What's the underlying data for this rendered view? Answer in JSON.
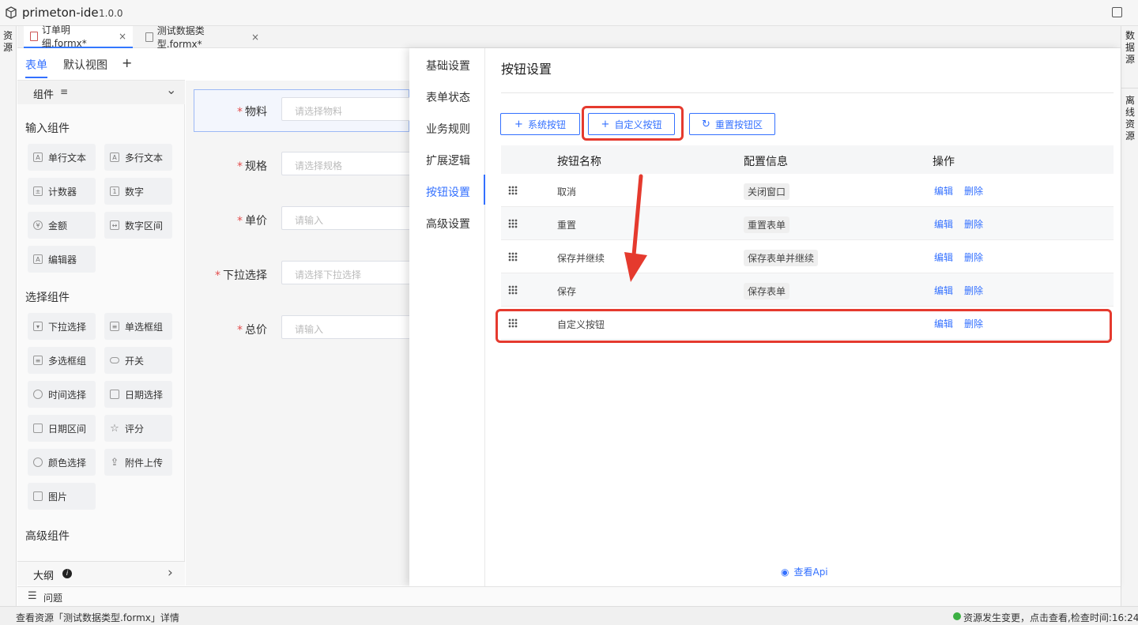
{
  "app": {
    "name": "primeton-ide",
    "version": "1.0.0"
  },
  "left_strip": {
    "label": "资源"
  },
  "right_strip": {
    "data_source": "数据源",
    "offline_resource": "离线资源"
  },
  "file_tabs": [
    {
      "label": "订单明细.formx*",
      "close": "×"
    },
    {
      "label": "测试数据类型.formx*",
      "close": "×"
    }
  ],
  "top_nav": {
    "form": "表单",
    "default_view": "默认视图",
    "add": "+"
  },
  "components": {
    "header": "组件",
    "header_icon": "≡",
    "chevron": "⌄",
    "input_title": "输入组件",
    "input_items": [
      "单行文本",
      "多行文本",
      "计数器",
      "数字",
      "金额",
      "数字区间",
      "编辑器"
    ],
    "select_title": "选择组件",
    "select_items": [
      "下拉选择",
      "单选框组",
      "多选框组",
      "开关",
      "时间选择",
      "日期选择",
      "日期区间",
      "评分",
      "颜色选择",
      "附件上传",
      "图片"
    ],
    "advanced_title": "高级组件"
  },
  "outline": {
    "label": "大纲",
    "info": "i",
    "chevron": "›"
  },
  "problems": {
    "label": "问题"
  },
  "form_fields": [
    {
      "label": "物料",
      "placeholder": "请选择物料"
    },
    {
      "label": "规格",
      "placeholder": "请选择规格"
    },
    {
      "label": "单价",
      "placeholder": "请输入"
    },
    {
      "label": "下拉选择",
      "placeholder": "请选择下拉选择"
    },
    {
      "label": "总价",
      "placeholder": "请输入"
    }
  ],
  "drawer": {
    "menu": [
      "基础设置",
      "表单状态",
      "业务规则",
      "扩展逻辑",
      "按钮设置",
      "高级设置"
    ],
    "active_menu": "按钮设置",
    "title": "按钮设置",
    "buttons": {
      "system": "系统按钮",
      "custom": "自定义按钮",
      "reset": "重置按钮区"
    },
    "table": {
      "headers": [
        "按钮名称",
        "配置信息",
        "操作"
      ],
      "rows": [
        {
          "name": "取消",
          "config": "关闭窗口",
          "edit": "编辑",
          "delete": "删除"
        },
        {
          "name": "重置",
          "config": "重置表单",
          "edit": "编辑",
          "delete": "删除"
        },
        {
          "name": "保存并继续",
          "config": "保存表单并继续",
          "edit": "编辑",
          "delete": "删除"
        },
        {
          "name": "保存",
          "config": "保存表单",
          "edit": "编辑",
          "delete": "删除"
        },
        {
          "name": "自定义按钮",
          "config": "",
          "edit": "编辑",
          "delete": "删除"
        }
      ]
    },
    "view_api": "查看Api"
  },
  "status": {
    "left": "查看资源「测试数据类型.formx」详情",
    "right": "资源发生变更，点击查看,检查时间:16:24",
    "dot_color": "#3cb043"
  },
  "colors": {
    "accent": "#3370ff",
    "annotation": "#e53a2e"
  }
}
